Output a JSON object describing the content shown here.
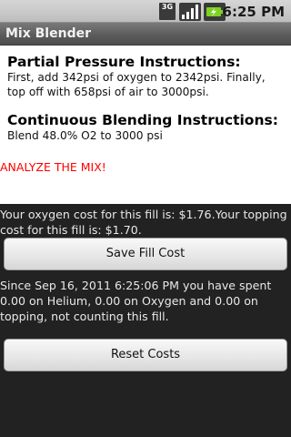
{
  "status_bar": {
    "network": "3G",
    "time": "6:25 PM",
    "icons": [
      "3g-icon",
      "signal-icon",
      "battery-charging-icon"
    ]
  },
  "app": {
    "title": "Mix Blender"
  },
  "partial_pressure": {
    "heading": "Partial Pressure Instructions:",
    "text": "First, add 342psi of oxygen to 2342psi. Finally, top off with 658psi of air to 3000psi."
  },
  "continuous": {
    "heading": "Continuous Blending Instructions:",
    "text": "Blend 48.0% O2 to 3000 psi"
  },
  "analyze_label": "ANALYZE THE MIX!",
  "cost_text": "Your oxygen cost for this fill is: $1.76.Your topping cost for this fill is: $1.70.",
  "save_button": "Save Fill Cost",
  "spent_text": "Since Sep 16, 2011 6:25:06 PM you have spent 0.00 on Helium, 0.00 on Oxygen and 0.00 on topping, not counting this fill.",
  "reset_button": "Reset Costs",
  "colors": {
    "warning": "#ff0000",
    "background": "#222222",
    "panel": "#ffffff"
  }
}
